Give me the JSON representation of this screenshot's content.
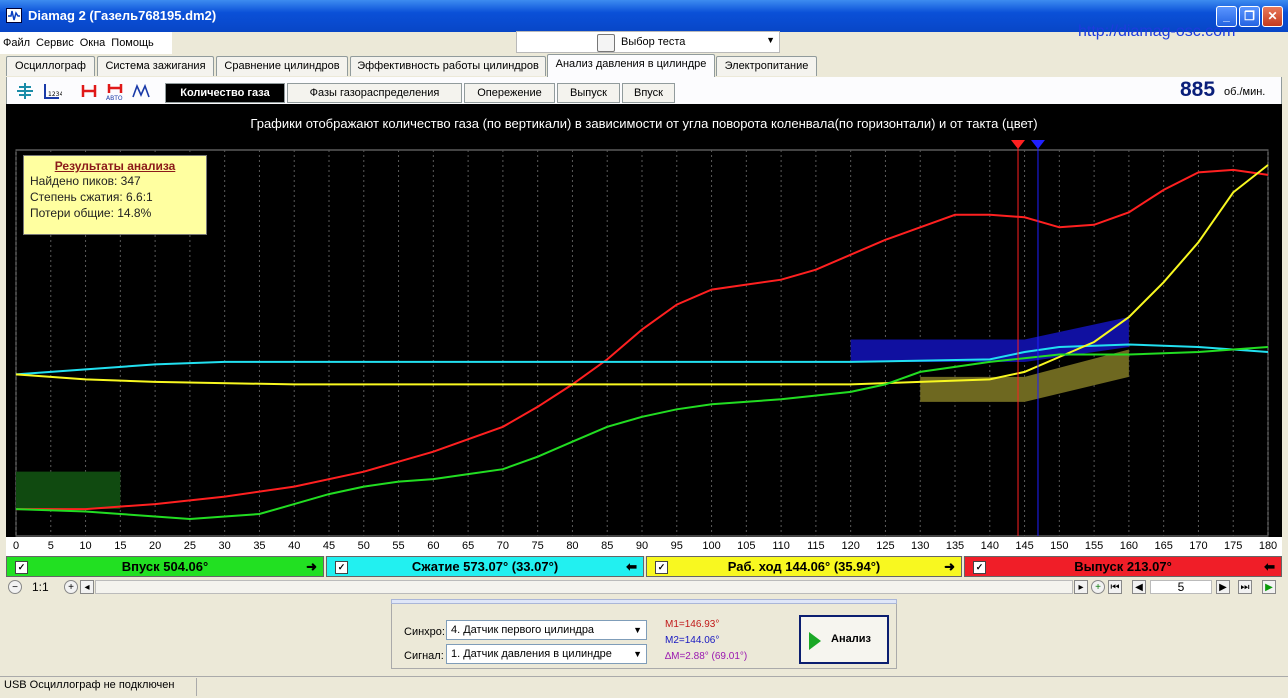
{
  "window": {
    "title": "Diamag 2 (Газель768195.dm2)",
    "url": "http://diamag-osc.com"
  },
  "menu": [
    "Файл",
    "Сервис",
    "Окна",
    "Помощь"
  ],
  "test_select": "Выбор теста",
  "tabs": [
    "Осциллограф",
    "Система зажигания",
    "Сравнение цилиндров",
    "Эффективность работы цилиндров",
    "Анализ давления в цилиндре",
    "Электропитание"
  ],
  "active_tab": "Анализ давления в цилиндре",
  "subtabs": [
    "Количество газа",
    "Фазы газораспределения",
    "Опережение",
    "Выпуск",
    "Впуск"
  ],
  "active_subtab": "Количество газа",
  "rpm": {
    "value": "885",
    "unit": "об./мин."
  },
  "chart_title": "Графики отображают количество газа (по вертикали) в зависимости от угла поворота коленвала(по горизонтали) и от такта (цвет)",
  "results": {
    "title": "Результаты анализа",
    "lines": [
      "Найдено пиков: 347",
      "Степень сжатия: 6.6:1",
      "Потери общие: 14.8%"
    ]
  },
  "strokes": [
    {
      "label": "Впуск 504.06°",
      "color": "#22e022",
      "arrow": "➜"
    },
    {
      "label": "Сжатие 573.07° (33.07°)",
      "color": "#22f0f0",
      "arrow": "⬅"
    },
    {
      "label": "Раб. ход 144.06° (35.94°)",
      "color": "#f8f820",
      "arrow": "➜"
    },
    {
      "label": "Выпуск 213.07°",
      "color": "#f01e28",
      "arrow": "⬅"
    }
  ],
  "zoom": "1:1",
  "page_num": "5",
  "synchro": {
    "label": "Синхро:",
    "value": "4.  Датчик первого цилиндра"
  },
  "signal": {
    "label": "Сигнал:",
    "value": "1.  Датчик давления в цилиндре"
  },
  "markers": {
    "m1": "M1=146.93°",
    "m2": "M2=144.06°",
    "dm": "∆M=2.88° (69.01°)"
  },
  "analyze_label": "Анализ",
  "status": "USB Осциллограф не подключен",
  "chart_data": {
    "type": "line",
    "x_ticks": [
      0,
      5,
      10,
      15,
      20,
      25,
      30,
      35,
      40,
      45,
      50,
      55,
      60,
      65,
      70,
      75,
      80,
      85,
      90,
      95,
      100,
      105,
      110,
      115,
      120,
      125,
      130,
      135,
      140,
      145,
      150,
      155,
      160,
      165,
      170,
      175,
      180
    ],
    "xlim": [
      0,
      180
    ],
    "series": [
      {
        "color": "#ff2020",
        "x": [
          0,
          10,
          20,
          30,
          40,
          50,
          60,
          70,
          75,
          80,
          85,
          90,
          95,
          100,
          105,
          110,
          115,
          120,
          125,
          130,
          135,
          140,
          145,
          150,
          155,
          160,
          165,
          170,
          175,
          180
        ],
        "y": [
          0.08,
          0.08,
          0.1,
          0.13,
          0.17,
          0.23,
          0.31,
          0.41,
          0.49,
          0.58,
          0.68,
          0.8,
          0.9,
          0.96,
          0.98,
          1.0,
          1.04,
          1.1,
          1.16,
          1.21,
          1.26,
          1.26,
          1.25,
          1.21,
          1.22,
          1.27,
          1.36,
          1.43,
          1.44,
          1.42
        ]
      },
      {
        "color": "#22e0f0",
        "x": [
          0,
          10,
          20,
          30,
          60,
          90,
          120,
          140,
          145,
          150,
          160,
          170,
          180
        ],
        "y": [
          0.62,
          0.64,
          0.66,
          0.67,
          0.67,
          0.67,
          0.67,
          0.68,
          0.71,
          0.73,
          0.74,
          0.73,
          0.71
        ]
      },
      {
        "color": "#f8f820",
        "x": [
          0,
          10,
          20,
          40,
          60,
          80,
          100,
          120,
          130,
          140,
          145,
          150,
          155,
          160,
          165,
          170,
          175,
          180
        ],
        "y": [
          0.62,
          0.6,
          0.59,
          0.58,
          0.58,
          0.58,
          0.58,
          0.58,
          0.59,
          0.6,
          0.63,
          0.69,
          0.75,
          0.85,
          0.99,
          1.15,
          1.35,
          1.46
        ]
      },
      {
        "color": "#22dd22",
        "x": [
          0,
          10,
          15,
          20,
          25,
          30,
          35,
          40,
          45,
          50,
          55,
          60,
          65,
          70,
          75,
          80,
          85,
          90,
          95,
          100,
          110,
          120,
          125,
          130,
          135,
          140,
          150,
          160,
          170,
          180
        ],
        "y": [
          0.08,
          0.07,
          0.06,
          0.05,
          0.04,
          0.05,
          0.06,
          0.1,
          0.14,
          0.17,
          0.19,
          0.2,
          0.22,
          0.24,
          0.29,
          0.35,
          0.41,
          0.45,
          0.48,
          0.5,
          0.52,
          0.55,
          0.58,
          0.63,
          0.65,
          0.67,
          0.7,
          0.7,
          0.71,
          0.73
        ]
      }
    ],
    "regions": [
      {
        "color": "#104a10",
        "x1": 0,
        "x2": 15,
        "y_low": 0.08,
        "y_high": 0.23
      },
      {
        "color": "#1010a0",
        "x1": 120,
        "x2": 145,
        "y_low": 0.67,
        "y_high": 0.76,
        "to_x": 160,
        "to_low": 0.73,
        "to_high": 0.85
      },
      {
        "color": "#6e6820",
        "x1": 130,
        "x2": 145,
        "y_low": 0.51,
        "y_high": 0.61,
        "to_x": 160,
        "to_low": 0.61,
        "to_high": 0.72
      }
    ],
    "cursors": [
      {
        "x": 144.06,
        "color": "#ff2020"
      },
      {
        "x": 146.93,
        "color": "#2020ff"
      }
    ],
    "ylim": [
      0,
      1.52
    ]
  }
}
